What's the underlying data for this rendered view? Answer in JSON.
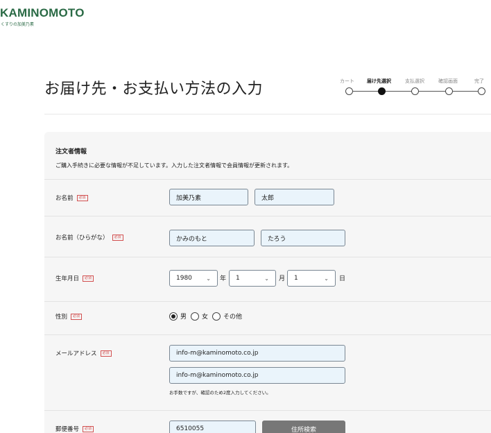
{
  "brand": {
    "name": "KAMINOMOTO",
    "sub": "くすりの加美乃素",
    "color": "#2a6a45"
  },
  "page_title": "お届け先・お支払い方法の入力",
  "steps": [
    {
      "label": "カート",
      "active": false
    },
    {
      "label": "届け先選択",
      "active": true
    },
    {
      "label": "支払選択",
      "active": false
    },
    {
      "label": "確認画面",
      "active": false
    },
    {
      "label": "完了",
      "active": false
    }
  ],
  "section": {
    "title": "注文者情報",
    "description": "ご購入手続きに必要な情報が不足しています。入力した注文者情報で会員情報が更新されます。"
  },
  "required_badge": "必須",
  "fields": {
    "name": {
      "label": "お名前",
      "last": "加美乃素",
      "first": "太郎"
    },
    "kana": {
      "label": "お名前（ひらがな）",
      "last": "かみのもと",
      "first": "たろう"
    },
    "birth": {
      "label": "生年月日",
      "year": "1980",
      "year_unit": "年",
      "month": "1",
      "month_unit": "月",
      "day": "1",
      "day_unit": "日"
    },
    "gender": {
      "label": "性別",
      "options": [
        "男",
        "女",
        "その他"
      ],
      "selected": "男"
    },
    "email": {
      "label": "メールアドレス",
      "value": "info-m@kaminomoto.co.jp",
      "confirm": "info-m@kaminomoto.co.jp",
      "note": "お手数ですが、確認のため2度入力してください。"
    },
    "postal": {
      "label": "郵便番号",
      "value": "6510055",
      "search_button": "住所検索"
    }
  }
}
